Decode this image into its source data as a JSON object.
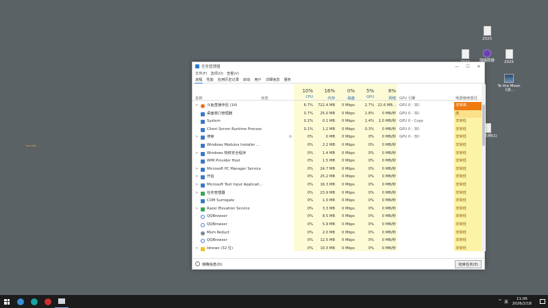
{
  "desktop": {
    "icons": [
      {
        "label": "2023"
      },
      {
        "label": "2024"
      },
      {
        "label": "嗨格转换"
      },
      {
        "label": "2025"
      },
      {
        "label": "To the Moon《去..."
      },
      {
        "label": "文本文档(1)"
      }
    ],
    "stray_text": "ayunday"
  },
  "window": {
    "title": "任务管理器",
    "controls": {
      "minimize": "—",
      "maximize": "☐",
      "close": "✕"
    },
    "menu": [
      "文件(F)",
      "选项(O)",
      "查看(V)"
    ],
    "tabs": [
      "进程",
      "性能",
      "应用历史记录",
      "启动",
      "用户",
      "详细信息",
      "服务"
    ],
    "active_tab": "进程",
    "header": {
      "name": "名称",
      "status": "状态",
      "cpu_pct": "10%",
      "cpu": "CPU",
      "mem_pct": "16%",
      "mem": "内存",
      "disk_pct": "0%",
      "disk": "磁盘",
      "gpu_pct": "5%",
      "gpu": "GPU",
      "net_pct": "8%",
      "net": "网络",
      "gpu_engine": "GPU 引擎",
      "power": "电源使用情况"
    },
    "processes": [
      {
        "name": "斗鱼直播伴侣 (14)",
        "exp": ">",
        "icon": "orange",
        "status": "",
        "cpu": "6.7%",
        "mem": "722.4 MB",
        "disk": "0 Mbps",
        "gpu": "2.7%",
        "net": "22.6 MB...",
        "gpu_engine": "GPU 0 - 3D",
        "power": "非常高",
        "power_level": "hot"
      },
      {
        "name": "桌面窗口管理器",
        "exp": "",
        "icon": "blue",
        "status": "",
        "cpu": "0.7%",
        "mem": "25.0 MB",
        "disk": "0 Mbps",
        "gpu": "1.8%",
        "net": "0 MB/秒",
        "gpu_engine": "GPU 0 - 3D",
        "power": "低",
        "power_level": "warm"
      },
      {
        "name": "System",
        "exp": "",
        "icon": "blue",
        "status": "",
        "cpu": "0.2%",
        "mem": "0.1 MB",
        "disk": "0 Mbps",
        "gpu": "1.4%",
        "net": "2.0 MB/秒",
        "gpu_engine": "GPU 0 - Copy",
        "power": "非常低",
        "power_level": "low"
      },
      {
        "name": "Client Server Runtime Process",
        "exp": "",
        "icon": "blue",
        "status": "",
        "cpu": "0.1%",
        "mem": "1.2 MB",
        "disk": "0 Mbps",
        "gpu": "0.3%",
        "net": "0 MB/秒",
        "gpu_engine": "GPU 0 - 3D",
        "power": "非常低",
        "power_level": "low"
      },
      {
        "name": "搜索",
        "exp": ">",
        "icon": "blue",
        "status": "⦶",
        "cpu": "0%",
        "mem": "0 MB",
        "disk": "0 Mbps",
        "gpu": "0%",
        "net": "0 MB/秒",
        "gpu_engine": "GPU 0 - 3D",
        "power": "非常低",
        "power_level": "low"
      },
      {
        "name": "Windows Modules Installer ...",
        "exp": "",
        "icon": "blue",
        "status": "",
        "cpu": "0%",
        "mem": "2.2 MB",
        "disk": "0 Mbps",
        "gpu": "0%",
        "net": "0 MB/秒",
        "gpu_engine": "",
        "power": "非常低",
        "power_level": "low"
      },
      {
        "name": "Windows 物体安全程序",
        "exp": ">",
        "icon": "blue",
        "status": "",
        "cpu": "0%",
        "mem": "1.4 MB",
        "disk": "0 Mbps",
        "gpu": "0%",
        "net": "0 MB/秒",
        "gpu_engine": "",
        "power": "非常低",
        "power_level": "low"
      },
      {
        "name": "WMI Provider Host",
        "exp": "",
        "icon": "blue",
        "status": "",
        "cpu": "0%",
        "mem": "1.5 MB",
        "disk": "0 Mbps",
        "gpu": "0%",
        "net": "0 MB/秒",
        "gpu_engine": "",
        "power": "非常低",
        "power_level": "low"
      },
      {
        "name": "Microsoft PC Manager Service",
        "exp": ">",
        "icon": "blue",
        "status": "",
        "cpu": "0%",
        "mem": "24.7 MB",
        "disk": "0 Mbps",
        "gpu": "0%",
        "net": "0 MB/秒",
        "gpu_engine": "",
        "power": "非常低",
        "power_level": "low"
      },
      {
        "name": "开始",
        "exp": ">",
        "icon": "blue",
        "status": "",
        "cpu": "0%",
        "mem": "25.2 MB",
        "disk": "0 Mbps",
        "gpu": "0%",
        "net": "0 MB/秒",
        "gpu_engine": "",
        "power": "非常低",
        "power_level": "low"
      },
      {
        "name": "Microsoft Text Input Applicati...",
        "exp": ">",
        "icon": "blue",
        "status": "",
        "cpu": "0%",
        "mem": "16.3 MB",
        "disk": "0 Mbps",
        "gpu": "0%",
        "net": "0 MB/秒",
        "gpu_engine": "",
        "power": "非常低",
        "power_level": "low"
      },
      {
        "name": "任务管理器",
        "exp": ">",
        "icon": "green",
        "status": "",
        "cpu": "0%",
        "mem": "23.9 MB",
        "disk": "0 Mbps",
        "gpu": "0%",
        "net": "0 MB/秒",
        "gpu_engine": "",
        "power": "非常低",
        "power_level": "low"
      },
      {
        "name": "COM Surrogate",
        "exp": "",
        "icon": "blue",
        "status": "",
        "cpu": "0%",
        "mem": "1.0 MB",
        "disk": "0 Mbps",
        "gpu": "0%",
        "net": "0 MB/秒",
        "gpu_engine": "",
        "power": "非常低",
        "power_level": "low"
      },
      {
        "name": "Razer Elevation Service",
        "exp": ">",
        "icon": "green",
        "status": "",
        "cpu": "0%",
        "mem": "3.3 MB",
        "disk": "0 Mbps",
        "gpu": "0%",
        "net": "0 MB/秒",
        "gpu_engine": "",
        "power": "非常低",
        "power_level": "low"
      },
      {
        "name": "QQBrowser",
        "exp": "",
        "icon": "qq",
        "status": "",
        "cpu": "0%",
        "mem": "8.5 MB",
        "disk": "0 Mbps",
        "gpu": "0%",
        "net": "0 MB/秒",
        "gpu_engine": "",
        "power": "非常低",
        "power_level": "low"
      },
      {
        "name": "QQBrowser",
        "exp": "",
        "icon": "qq",
        "status": "",
        "cpu": "0%",
        "mem": "5.9 MB",
        "disk": "0 Mbps",
        "gpu": "0%",
        "net": "0 MB/秒",
        "gpu_engine": "",
        "power": "非常低",
        "power_level": "low"
      },
      {
        "name": "Mem Reduct",
        "exp": "",
        "icon": "gear",
        "status": "",
        "cpu": "0%",
        "mem": "2.0 MB",
        "disk": "0 Mbps",
        "gpu": "0%",
        "net": "0 MB/秒",
        "gpu_engine": "",
        "power": "非常低",
        "power_level": "low"
      },
      {
        "name": "QQBrowser",
        "exp": "",
        "icon": "qq",
        "status": "",
        "cpu": "0%",
        "mem": "12.5 MB",
        "disk": "0 Mbps",
        "gpu": "0%",
        "net": "0 MB/秒",
        "gpu_engine": "",
        "power": "非常低",
        "power_level": "low"
      },
      {
        "name": "Idnews (32 位)",
        "exp": ">",
        "icon": "yellow",
        "status": "",
        "cpu": "0%",
        "mem": "10.3 MB",
        "disk": "0 Mbps",
        "gpu": "0%",
        "net": "0 MB/秒",
        "gpu_engine": "",
        "power": "非常低",
        "power_level": "low"
      }
    ],
    "footer": {
      "less_details": "简略信息(D)",
      "end_task": "结束任务(E)"
    }
  },
  "taskbar": {
    "start_icon": "windows-logo-icon",
    "ime": "英",
    "time": "11:06",
    "date": "2026/2/18",
    "tray_arrow": "^"
  },
  "colors": {
    "desktop_bg": "#5b6266",
    "heat_col": "#fdfbd6",
    "power_hot": "#ee7a10",
    "accent": "#2d7bd6"
  }
}
